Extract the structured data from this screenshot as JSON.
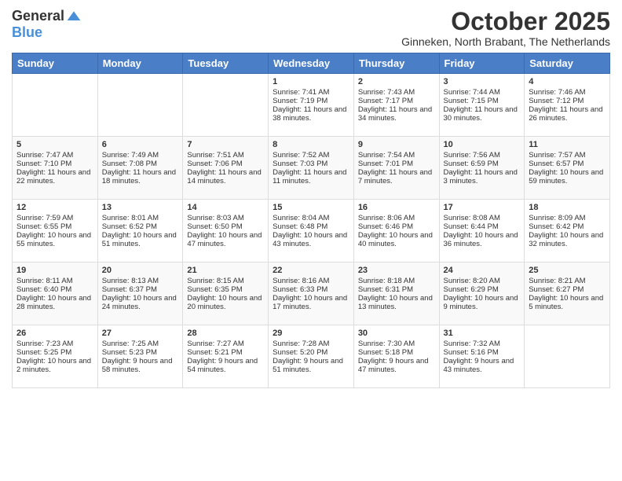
{
  "header": {
    "logo_general": "General",
    "logo_blue": "Blue",
    "month_title": "October 2025",
    "location": "Ginneken, North Brabant, The Netherlands"
  },
  "weekdays": [
    "Sunday",
    "Monday",
    "Tuesday",
    "Wednesday",
    "Thursday",
    "Friday",
    "Saturday"
  ],
  "weeks": [
    [
      {
        "day": "",
        "sunrise": "",
        "sunset": "",
        "daylight": ""
      },
      {
        "day": "",
        "sunrise": "",
        "sunset": "",
        "daylight": ""
      },
      {
        "day": "",
        "sunrise": "",
        "sunset": "",
        "daylight": ""
      },
      {
        "day": "1",
        "sunrise": "Sunrise: 7:41 AM",
        "sunset": "Sunset: 7:19 PM",
        "daylight": "Daylight: 11 hours and 38 minutes."
      },
      {
        "day": "2",
        "sunrise": "Sunrise: 7:43 AM",
        "sunset": "Sunset: 7:17 PM",
        "daylight": "Daylight: 11 hours and 34 minutes."
      },
      {
        "day": "3",
        "sunrise": "Sunrise: 7:44 AM",
        "sunset": "Sunset: 7:15 PM",
        "daylight": "Daylight: 11 hours and 30 minutes."
      },
      {
        "day": "4",
        "sunrise": "Sunrise: 7:46 AM",
        "sunset": "Sunset: 7:12 PM",
        "daylight": "Daylight: 11 hours and 26 minutes."
      }
    ],
    [
      {
        "day": "5",
        "sunrise": "Sunrise: 7:47 AM",
        "sunset": "Sunset: 7:10 PM",
        "daylight": "Daylight: 11 hours and 22 minutes."
      },
      {
        "day": "6",
        "sunrise": "Sunrise: 7:49 AM",
        "sunset": "Sunset: 7:08 PM",
        "daylight": "Daylight: 11 hours and 18 minutes."
      },
      {
        "day": "7",
        "sunrise": "Sunrise: 7:51 AM",
        "sunset": "Sunset: 7:06 PM",
        "daylight": "Daylight: 11 hours and 14 minutes."
      },
      {
        "day": "8",
        "sunrise": "Sunrise: 7:52 AM",
        "sunset": "Sunset: 7:03 PM",
        "daylight": "Daylight: 11 hours and 11 minutes."
      },
      {
        "day": "9",
        "sunrise": "Sunrise: 7:54 AM",
        "sunset": "Sunset: 7:01 PM",
        "daylight": "Daylight: 11 hours and 7 minutes."
      },
      {
        "day": "10",
        "sunrise": "Sunrise: 7:56 AM",
        "sunset": "Sunset: 6:59 PM",
        "daylight": "Daylight: 11 hours and 3 minutes."
      },
      {
        "day": "11",
        "sunrise": "Sunrise: 7:57 AM",
        "sunset": "Sunset: 6:57 PM",
        "daylight": "Daylight: 10 hours and 59 minutes."
      }
    ],
    [
      {
        "day": "12",
        "sunrise": "Sunrise: 7:59 AM",
        "sunset": "Sunset: 6:55 PM",
        "daylight": "Daylight: 10 hours and 55 minutes."
      },
      {
        "day": "13",
        "sunrise": "Sunrise: 8:01 AM",
        "sunset": "Sunset: 6:52 PM",
        "daylight": "Daylight: 10 hours and 51 minutes."
      },
      {
        "day": "14",
        "sunrise": "Sunrise: 8:03 AM",
        "sunset": "Sunset: 6:50 PM",
        "daylight": "Daylight: 10 hours and 47 minutes."
      },
      {
        "day": "15",
        "sunrise": "Sunrise: 8:04 AM",
        "sunset": "Sunset: 6:48 PM",
        "daylight": "Daylight: 10 hours and 43 minutes."
      },
      {
        "day": "16",
        "sunrise": "Sunrise: 8:06 AM",
        "sunset": "Sunset: 6:46 PM",
        "daylight": "Daylight: 10 hours and 40 minutes."
      },
      {
        "day": "17",
        "sunrise": "Sunrise: 8:08 AM",
        "sunset": "Sunset: 6:44 PM",
        "daylight": "Daylight: 10 hours and 36 minutes."
      },
      {
        "day": "18",
        "sunrise": "Sunrise: 8:09 AM",
        "sunset": "Sunset: 6:42 PM",
        "daylight": "Daylight: 10 hours and 32 minutes."
      }
    ],
    [
      {
        "day": "19",
        "sunrise": "Sunrise: 8:11 AM",
        "sunset": "Sunset: 6:40 PM",
        "daylight": "Daylight: 10 hours and 28 minutes."
      },
      {
        "day": "20",
        "sunrise": "Sunrise: 8:13 AM",
        "sunset": "Sunset: 6:37 PM",
        "daylight": "Daylight: 10 hours and 24 minutes."
      },
      {
        "day": "21",
        "sunrise": "Sunrise: 8:15 AM",
        "sunset": "Sunset: 6:35 PM",
        "daylight": "Daylight: 10 hours and 20 minutes."
      },
      {
        "day": "22",
        "sunrise": "Sunrise: 8:16 AM",
        "sunset": "Sunset: 6:33 PM",
        "daylight": "Daylight: 10 hours and 17 minutes."
      },
      {
        "day": "23",
        "sunrise": "Sunrise: 8:18 AM",
        "sunset": "Sunset: 6:31 PM",
        "daylight": "Daylight: 10 hours and 13 minutes."
      },
      {
        "day": "24",
        "sunrise": "Sunrise: 8:20 AM",
        "sunset": "Sunset: 6:29 PM",
        "daylight": "Daylight: 10 hours and 9 minutes."
      },
      {
        "day": "25",
        "sunrise": "Sunrise: 8:21 AM",
        "sunset": "Sunset: 6:27 PM",
        "daylight": "Daylight: 10 hours and 5 minutes."
      }
    ],
    [
      {
        "day": "26",
        "sunrise": "Sunrise: 7:23 AM",
        "sunset": "Sunset: 5:25 PM",
        "daylight": "Daylight: 10 hours and 2 minutes."
      },
      {
        "day": "27",
        "sunrise": "Sunrise: 7:25 AM",
        "sunset": "Sunset: 5:23 PM",
        "daylight": "Daylight: 9 hours and 58 minutes."
      },
      {
        "day": "28",
        "sunrise": "Sunrise: 7:27 AM",
        "sunset": "Sunset: 5:21 PM",
        "daylight": "Daylight: 9 hours and 54 minutes."
      },
      {
        "day": "29",
        "sunrise": "Sunrise: 7:28 AM",
        "sunset": "Sunset: 5:20 PM",
        "daylight": "Daylight: 9 hours and 51 minutes."
      },
      {
        "day": "30",
        "sunrise": "Sunrise: 7:30 AM",
        "sunset": "Sunset: 5:18 PM",
        "daylight": "Daylight: 9 hours and 47 minutes."
      },
      {
        "day": "31",
        "sunrise": "Sunrise: 7:32 AM",
        "sunset": "Sunset: 5:16 PM",
        "daylight": "Daylight: 9 hours and 43 minutes."
      },
      {
        "day": "",
        "sunrise": "",
        "sunset": "",
        "daylight": ""
      }
    ]
  ]
}
